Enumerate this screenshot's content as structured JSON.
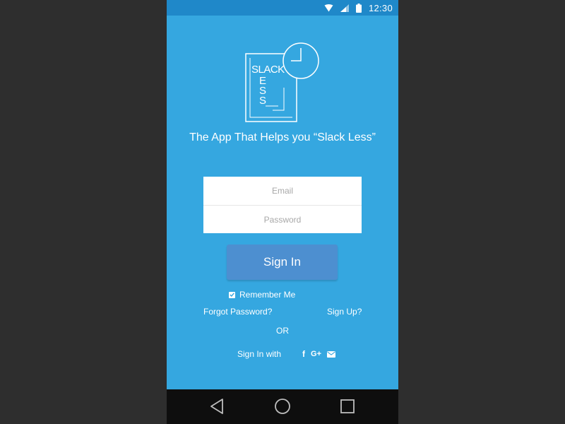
{
  "status_bar": {
    "time": "12:30",
    "icons": [
      "wifi-icon",
      "signal-icon",
      "battery-icon"
    ]
  },
  "logo": {
    "top_text": "SLACK",
    "vertical_letters": [
      "L",
      "E",
      "S",
      "S"
    ],
    "icon": "clock-icon"
  },
  "tagline": "The App That Helps you “Slack Less”",
  "form": {
    "email_placeholder": "Email",
    "password_placeholder": "Password",
    "email_value": "",
    "password_value": ""
  },
  "signin_button": "Sign In",
  "remember_me": {
    "label": "Remember Me",
    "checked": true
  },
  "links": {
    "forgot_password": "Forgot Password?",
    "sign_up": "Sign Up?"
  },
  "or_text": "OR",
  "social": {
    "label": "Sign In with",
    "facebook": "f",
    "google": "G+",
    "icons": [
      "facebook-icon",
      "google-plus-icon",
      "email-icon"
    ]
  },
  "nav": {
    "icons": [
      "back-icon",
      "home-icon",
      "recents-icon"
    ]
  },
  "colors": {
    "background": "#35a7e0",
    "status_bar": "#1f88c9",
    "button": "#4d8fd0",
    "nav_bar": "#0e0e0e"
  }
}
